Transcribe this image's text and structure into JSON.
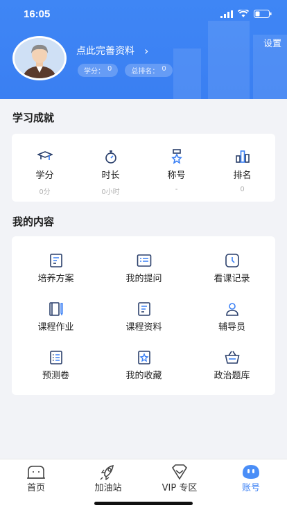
{
  "status_bar": {
    "time": "16:05"
  },
  "header": {
    "settings_label": "设置",
    "profile_prompt": "点此完善资料",
    "chevron": "›",
    "credits_label": "学分：",
    "credits_value": "0",
    "rank_label": "总排名：",
    "rank_value": "0"
  },
  "achievements": {
    "title": "学习成就",
    "items": [
      {
        "label": "学分",
        "value": "0分",
        "icon": "graduation-cap-icon"
      },
      {
        "label": "时长",
        "value": "0小时",
        "icon": "stopwatch-icon"
      },
      {
        "label": "称号",
        "value": "-",
        "icon": "medal-icon"
      },
      {
        "label": "排名",
        "value": "0",
        "icon": "ranking-bars-icon"
      }
    ]
  },
  "my_content": {
    "title": "我的内容",
    "items": [
      {
        "label": "培养方案",
        "icon": "plan-document-icon"
      },
      {
        "label": "我的提问",
        "icon": "question-list-icon"
      },
      {
        "label": "看课记录",
        "icon": "clock-history-icon"
      },
      {
        "label": "课程作业",
        "icon": "notebook-pen-icon"
      },
      {
        "label": "课程资料",
        "icon": "document-icon"
      },
      {
        "label": "辅导员",
        "icon": "person-icon"
      },
      {
        "label": "预测卷",
        "icon": "checklist-icon"
      },
      {
        "label": "我的收藏",
        "icon": "star-bookmark-icon"
      },
      {
        "label": "政治题库",
        "icon": "basket-icon"
      }
    ]
  },
  "tabbar": {
    "items": [
      {
        "label": "首页",
        "icon": "home-face-icon",
        "active": false
      },
      {
        "label": "加油站",
        "icon": "rocket-icon",
        "active": false
      },
      {
        "label": "VIP 专区",
        "icon": "vip-diamond-icon",
        "active": false
      },
      {
        "label": "账号",
        "icon": "account-face-icon",
        "active": true
      }
    ]
  },
  "colors": {
    "accent": "#3b80f5",
    "header": "#3f86f5",
    "background": "#f2f3f7",
    "icon_navy": "#2a3f6b"
  }
}
